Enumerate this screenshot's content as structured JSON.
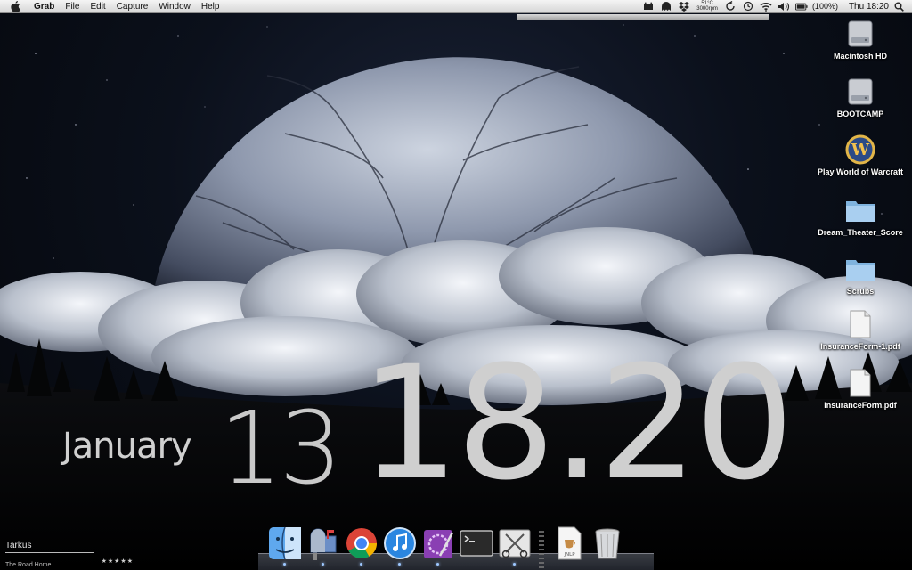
{
  "menubar": {
    "app_name": "Grab",
    "menus": [
      "File",
      "Edit",
      "Capture",
      "Window",
      "Help"
    ],
    "temperature": "51°C",
    "fan_speed": "3000rpm",
    "battery": "(100%)",
    "clock": "Thu 18:20"
  },
  "desktop_icons": [
    {
      "label": "Macintosh HD",
      "icon": "hard-drive-icon"
    },
    {
      "label": "BOOTCAMP",
      "icon": "hard-drive-icon"
    },
    {
      "label": "Play World of Warcraft",
      "icon": "warcraft-icon"
    },
    {
      "label": "Dream_Theater_Score",
      "icon": "folder-icon"
    },
    {
      "label": "Scrubs",
      "icon": "folder-icon"
    },
    {
      "label": "InsuranceForm-1.pdf",
      "icon": "pdf-document-icon"
    },
    {
      "label": "InsuranceForm.pdf",
      "icon": "pdf-document-icon"
    }
  ],
  "clock_widget": {
    "month": "January",
    "day": "13",
    "time": "18.20"
  },
  "now_playing": {
    "artist": "Tarkus",
    "song": "The Road Home",
    "rating_stars": "★★★★★"
  },
  "dock": {
    "items": [
      {
        "name": "finder-icon",
        "running": true
      },
      {
        "name": "mail-icon",
        "running": true
      },
      {
        "name": "chrome-icon",
        "running": true
      },
      {
        "name": "itunes-icon",
        "running": true
      },
      {
        "name": "pages-icon",
        "running": true
      },
      {
        "name": "terminal-icon",
        "running": false
      },
      {
        "name": "grab-icon",
        "running": true
      },
      {
        "name": "jnlp-document-icon",
        "running": false,
        "label": "JNLP"
      },
      {
        "name": "trash-icon",
        "running": false
      }
    ]
  },
  "colors": {
    "menubar": "#e6e6e6",
    "clock_text": "#cfcfcf",
    "dock_indicator": "#9ec8ff"
  }
}
